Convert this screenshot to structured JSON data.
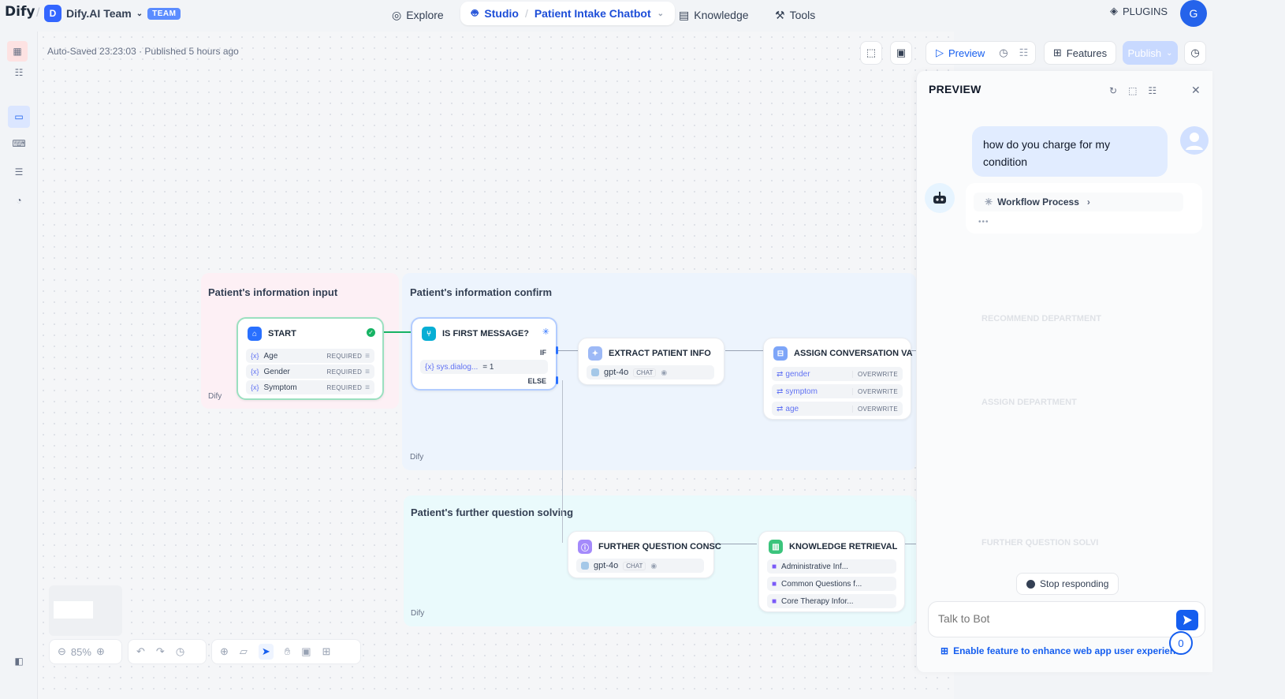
{
  "app": {
    "logo": "Dify"
  },
  "workspace": {
    "initial": "D",
    "name": "Dify.AI Team",
    "badge": "TEAM"
  },
  "nav": {
    "explore": "Explore",
    "studio": "Studio",
    "app_name": "Patient Intake Chatbot",
    "knowledge": "Knowledge",
    "tools": "Tools",
    "plugins": "PLUGINS",
    "user_initial": "G"
  },
  "status": {
    "autosave": "Auto-Saved 23:23:03 · Published 5 hours ago"
  },
  "toolbar": {
    "preview": "Preview",
    "features": "Features",
    "publish": "Publish"
  },
  "groups": {
    "input": {
      "title": "Patient's information input",
      "footer": "Dify"
    },
    "confirm": {
      "title": "Patient's information confirm",
      "footer": "Dify"
    },
    "further": {
      "title": "Patient's further question solving",
      "footer": "Dify"
    }
  },
  "nodes": {
    "start": {
      "title": "START",
      "fields": [
        {
          "var": "{x}",
          "name": "Age",
          "tag": "REQUIRED"
        },
        {
          "var": "{x}",
          "name": "Gender",
          "tag": "REQUIRED"
        },
        {
          "var": "{x}",
          "name": "Symptom",
          "tag": "REQUIRED"
        }
      ]
    },
    "ifelse": {
      "title": "IS FIRST MESSAGE?",
      "if_label": "IF",
      "condition_var": "{x} sys.dialog...",
      "condition_op": "= 1",
      "else_label": "ELSE"
    },
    "extract": {
      "title": "EXTRACT PATIENT INFO",
      "model": "gpt-4o",
      "mode": "CHAT"
    },
    "assign": {
      "title": "ASSIGN CONVERSATION VA",
      "vars": [
        {
          "name": "gender",
          "op": "OVERWRITE"
        },
        {
          "name": "symptom",
          "op": "OVERWRITE"
        },
        {
          "name": "age",
          "op": "OVERWRITE"
        }
      ]
    },
    "further": {
      "title": "FURTHER QUESTION CONSC",
      "model": "gpt-4o",
      "mode": "CHAT"
    },
    "knowledge": {
      "title": "KNOWLEDGE RETRIEVAL",
      "docs": [
        "Administrative Inf...",
        "Common Questions f...",
        "Core Therapy Infor..."
      ]
    },
    "faded": {
      "recommend": "RECOMMEND DEPARTMENT",
      "assign_dept": "ASSIGN DEPARTMENT",
      "further_solve": "FURTHER QUESTION SOLVI"
    }
  },
  "zoom": {
    "level": "85%"
  },
  "preview": {
    "title": "PREVIEW",
    "user_message": "how do you charge for my condition",
    "workflow_label": "Workflow Process",
    "stop_label": "Stop responding",
    "input_placeholder": "Talk to Bot",
    "enable_text": "Enable feature to enhance web app user experience",
    "counter": "0"
  }
}
